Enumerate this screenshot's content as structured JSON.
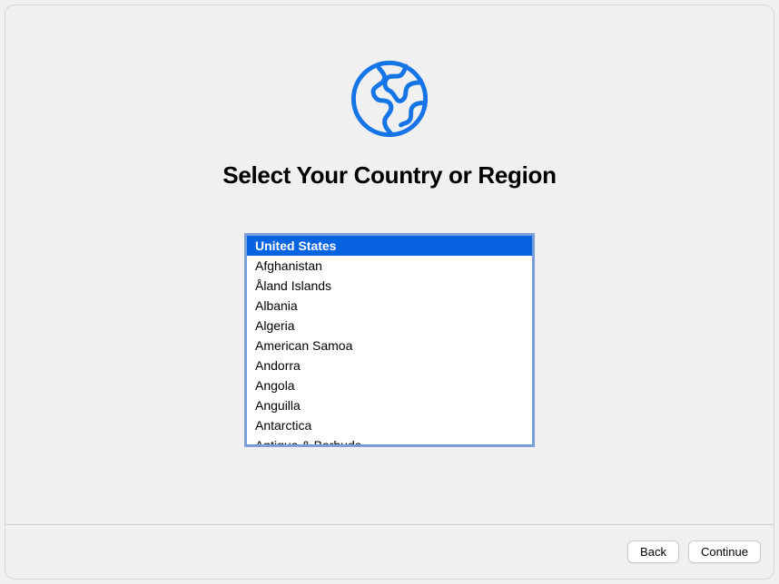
{
  "icon": "globe-icon",
  "title": "Select Your Country or Region",
  "countries": [
    {
      "name": "United States",
      "selected": true
    },
    {
      "name": "Afghanistan",
      "selected": false
    },
    {
      "name": "Åland Islands",
      "selected": false
    },
    {
      "name": "Albania",
      "selected": false
    },
    {
      "name": "Algeria",
      "selected": false
    },
    {
      "name": "American Samoa",
      "selected": false
    },
    {
      "name": "Andorra",
      "selected": false
    },
    {
      "name": "Angola",
      "selected": false
    },
    {
      "name": "Anguilla",
      "selected": false
    },
    {
      "name": "Antarctica",
      "selected": false
    },
    {
      "name": "Antigua & Barbuda",
      "selected": false
    }
  ],
  "buttons": {
    "back": "Back",
    "continue": "Continue"
  },
  "colors": {
    "accent": "#0863e1",
    "listBorder": "#7a9fd6"
  }
}
